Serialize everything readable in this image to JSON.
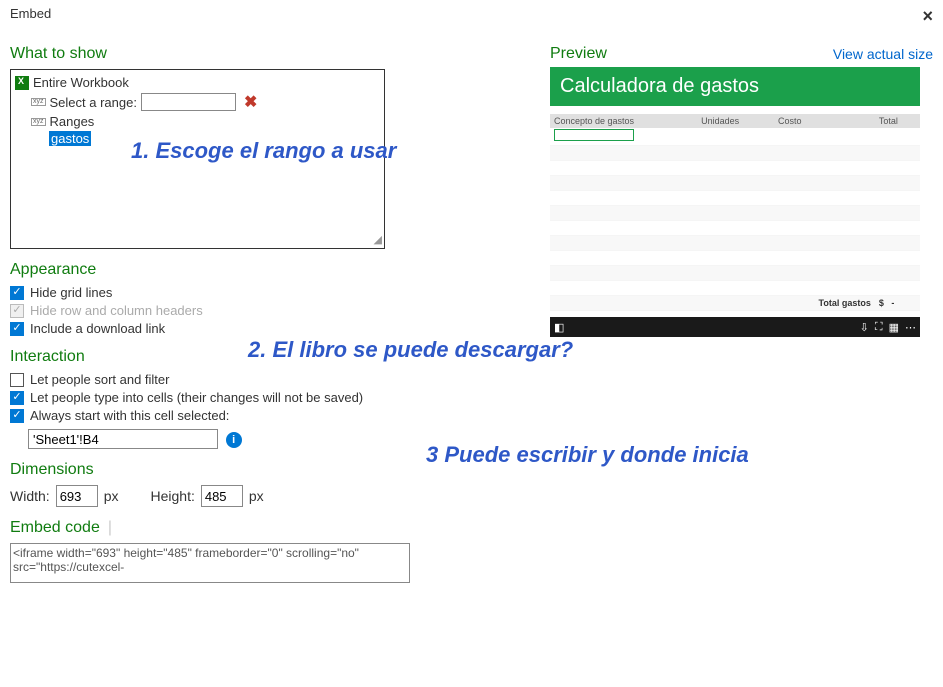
{
  "dialog": {
    "title": "Embed",
    "close_aria": "Close"
  },
  "what_to_show": {
    "title": "What to show",
    "workbook_label": "Entire Workbook",
    "select_range_label": "Select a range:",
    "select_range_value": "",
    "ranges_label": "Ranges",
    "selected_range_name": "gastos"
  },
  "appearance": {
    "title": "Appearance",
    "hide_gridlines": {
      "label": "Hide grid lines",
      "checked": true
    },
    "hide_headers": {
      "label": "Hide row and column headers",
      "checked": true,
      "disabled": true
    },
    "download_link": {
      "label": "Include a download link",
      "checked": true
    }
  },
  "interaction": {
    "title": "Interaction",
    "sort_filter": {
      "label": "Let people sort and filter",
      "checked": false
    },
    "type_cells": {
      "label": "Let people type into cells (their changes will not be saved)",
      "checked": true
    },
    "start_cell": {
      "label": "Always start with this cell selected:",
      "checked": true,
      "value": "'Sheet1'!B4"
    }
  },
  "dimensions": {
    "title": "Dimensions",
    "width_label": "Width:",
    "width_value": "693",
    "width_unit": "px",
    "height_label": "Height:",
    "height_value": "485",
    "height_unit": "px"
  },
  "embed_code": {
    "title": "Embed code",
    "value": "<iframe width=\"693\" height=\"485\" frameborder=\"0\" scrolling=\"no\" src=\"https://cutexcel-"
  },
  "preview": {
    "title": "Preview",
    "view_actual_link": "View actual size",
    "sheet_title": "Calculadora de gastos",
    "cols": [
      "Concepto de gastos",
      "Unidades",
      "Costo",
      "Total"
    ],
    "total_label": "Total gastos",
    "currency": "$",
    "total_value": "-"
  },
  "annotations": {
    "a1": "1. Escoge el rango a usar",
    "a2": "2. El libro se puede descargar?",
    "a3": "3 Puede escribir y donde inicia"
  }
}
